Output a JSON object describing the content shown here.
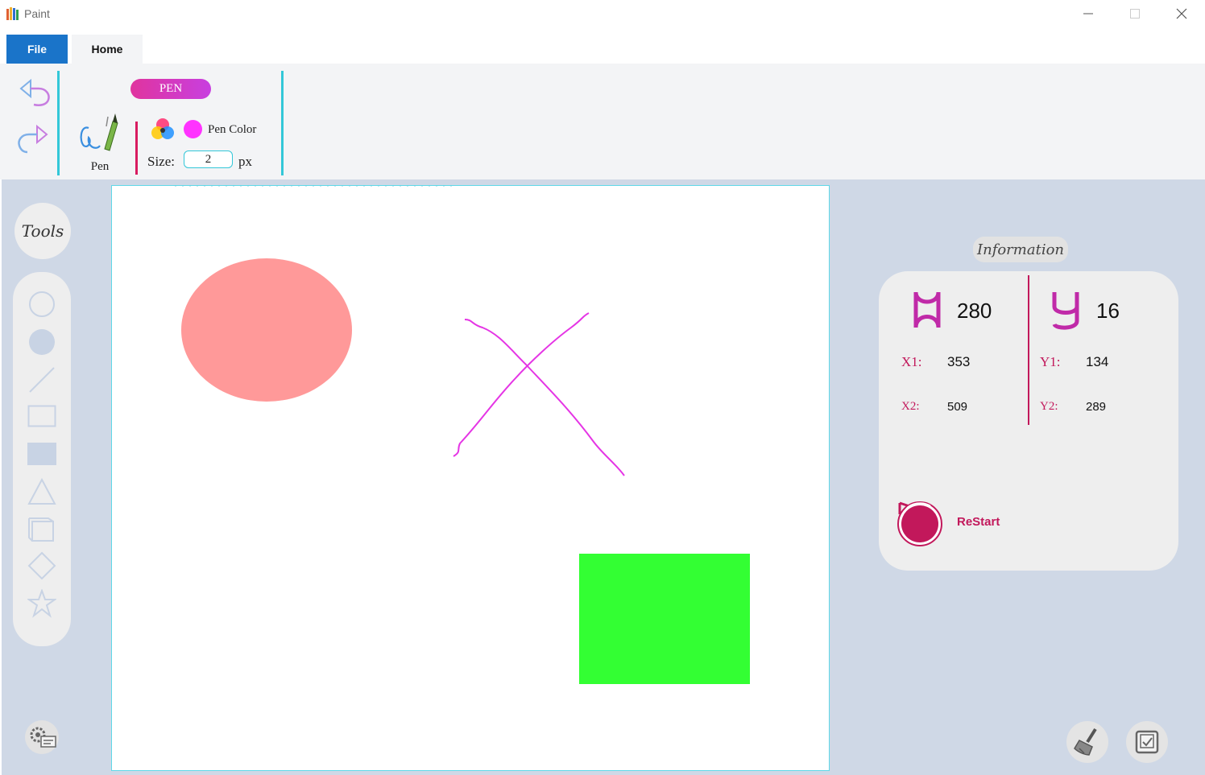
{
  "window": {
    "title": "Paint",
    "minimize_icon": "minimize-icon",
    "maximize_icon": "maximize-icon",
    "close_icon": "close-icon"
  },
  "tabs": {
    "file": "File",
    "home": "Home"
  },
  "ribbon": {
    "mode_badge": "PEN",
    "pen_label": "Pen",
    "pen_color_label": "Pen Color",
    "pen_color": "#ff33ff",
    "size_label": "Size:",
    "size_value": "2",
    "size_unit": "px"
  },
  "tools": {
    "title": "Tools",
    "items": [
      "circle-outline",
      "circle-filled",
      "line",
      "rectangle-outline",
      "rectangle-filled",
      "triangle",
      "cube",
      "diamond",
      "star"
    ]
  },
  "canvas": {
    "shapes": [
      {
        "kind": "ellipse",
        "color": "#ff9999"
      },
      {
        "kind": "freehand-x",
        "color": "#e535e5"
      },
      {
        "kind": "rectangle",
        "color": "#33ff33"
      }
    ]
  },
  "info": {
    "title": "Information",
    "x_value": "280",
    "y_value": "16",
    "x1_label": "X1:",
    "x1_value": "353",
    "y1_label": "Y1:",
    "y1_value": "134",
    "x2_label": "X2:",
    "x2_value": "509",
    "y2_label": "Y2:",
    "y2_value": "289",
    "restart_label": "ReStart"
  },
  "colors": {
    "accent": "#33c7d8",
    "brand": "#c2185b",
    "file_tab": "#1a74c9",
    "workspace": "#cfd8e6"
  }
}
